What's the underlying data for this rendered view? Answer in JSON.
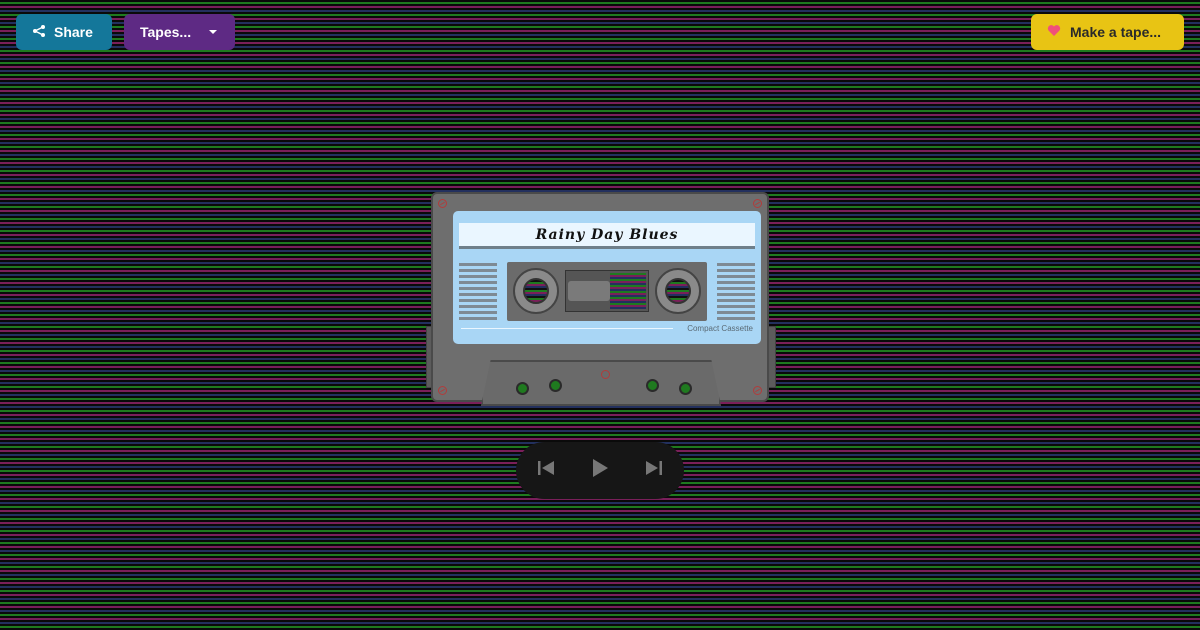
{
  "toolbar": {
    "share_label": "Share",
    "tapes_label": "Tapes...",
    "make_tape_label": "Make a tape..."
  },
  "cassette": {
    "title": "Rainy Day Blues",
    "brand": "Compact Cassette"
  },
  "icons": {
    "share": "share-icon",
    "dropdown": "chevron-down-icon",
    "heart": "heart-icon",
    "previous": "skip-previous-icon",
    "play": "play-icon",
    "next": "skip-next-icon"
  },
  "colors": {
    "share_button": "#14779a",
    "tapes_button": "#5e2a84",
    "make_tape_button": "#e8c414",
    "heart": "#f0507a",
    "label": "#a9d6f5"
  }
}
